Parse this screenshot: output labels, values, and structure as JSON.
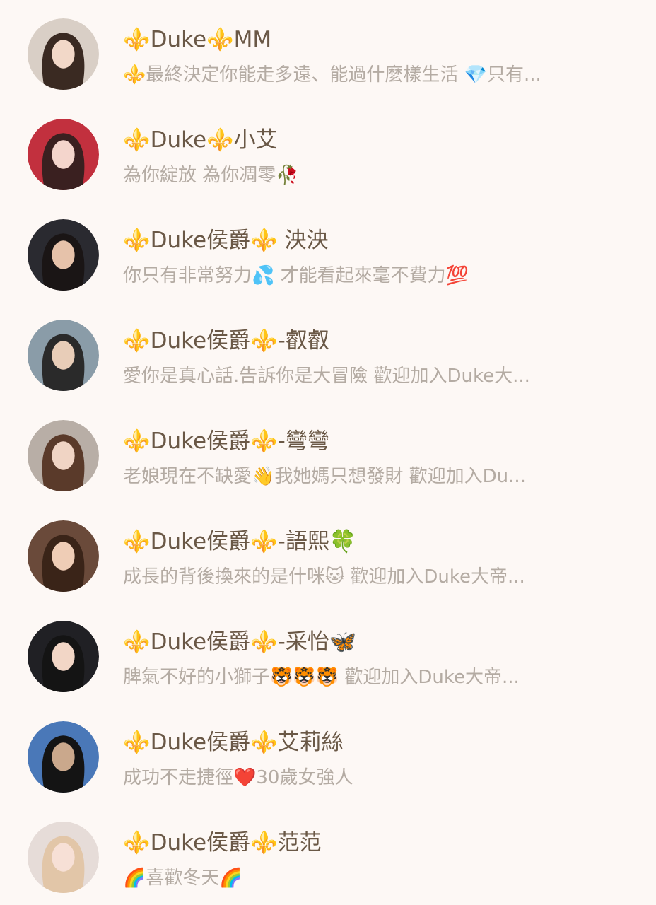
{
  "contacts": [
    {
      "name": "⚜️Duke⚜️MM",
      "message": "⚜️最終決定你能走多遠、能過什麼樣生活 💎只有...",
      "avatar_colors": [
        "#d9cfc6",
        "#3a2a22",
        "#f2d8c8"
      ]
    },
    {
      "name": "⚜️Duke⚜️小艾",
      "message": "為你綻放 為你凋零🥀",
      "avatar_colors": [
        "#c2303e",
        "#3a2020",
        "#f4d5cc"
      ]
    },
    {
      "name": "⚜️Duke侯爵⚜️ 泱泱",
      "message": "你只有非常努力💦 才能看起來毫不費力💯",
      "avatar_colors": [
        "#2a2a30",
        "#1a1515",
        "#e6c2aa"
      ]
    },
    {
      "name": "⚜️Duke侯爵⚜️-叡叡",
      "message": "愛你是真心話.告訴你是大冒險  歡迎加入Duke大...",
      "avatar_colors": [
        "#8a9ca8",
        "#2a2a2a",
        "#e8cdb8"
      ]
    },
    {
      "name": "⚜️Duke侯爵⚜️-彎彎",
      "message": "老娘現在不缺愛👋我她媽只想發財    歡迎加入Du...",
      "avatar_colors": [
        "#b8aea6",
        "#5a3a2a",
        "#f0d4c4"
      ]
    },
    {
      "name": "⚜️Duke侯爵⚜️-語熙🍀",
      "message": "成長的背後換來的是什咪🐱  歡迎加入Duke大帝...",
      "avatar_colors": [
        "#6a4a3a",
        "#3a2418",
        "#efcdb6"
      ]
    },
    {
      "name": "⚜️Duke侯爵⚜️-采怡🦋",
      "message": "脾氣不好的小獅子🐯🐯🐯   歡迎加入Duke大帝...",
      "avatar_colors": [
        "#202024",
        "#141414",
        "#f2d6c6"
      ]
    },
    {
      "name": "⚜️Duke侯爵⚜️艾莉絲",
      "message": "成功不走捷徑❤️30歲女強人",
      "avatar_colors": [
        "#4a78b8",
        "#141414",
        "#caa88c"
      ]
    },
    {
      "name": "⚜️Duke侯爵⚜️范范",
      "message": "🌈喜歡冬天🌈",
      "avatar_colors": [
        "#e6dcd8",
        "#e2c6a8",
        "#f7e0d6"
      ]
    }
  ]
}
